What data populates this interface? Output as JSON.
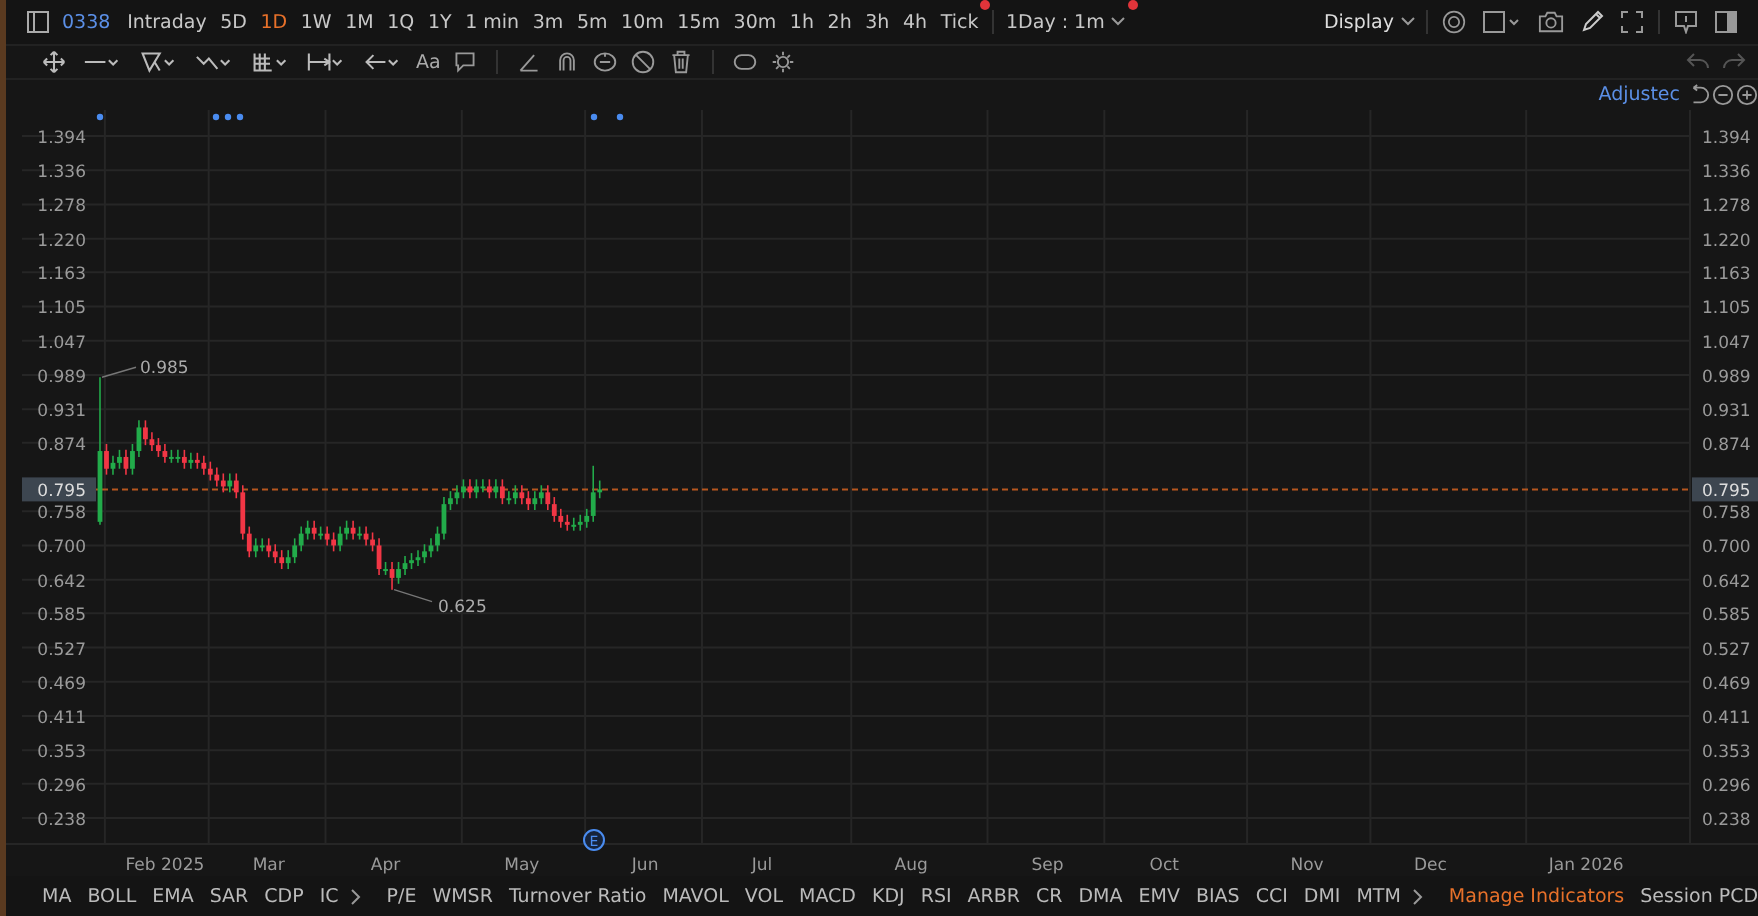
{
  "toolbar": {
    "symbol": "0338",
    "intervals": [
      {
        "label": "Intraday",
        "selected": false,
        "notification": false
      },
      {
        "label": "5D",
        "selected": false,
        "notification": false
      },
      {
        "label": "1D",
        "selected": true,
        "notification": false
      },
      {
        "label": "1W",
        "selected": false,
        "notification": false
      },
      {
        "label": "1M",
        "selected": false,
        "notification": false
      },
      {
        "label": "1Q",
        "selected": false,
        "notification": false
      },
      {
        "label": "1Y",
        "selected": false,
        "notification": false
      },
      {
        "label": "1 min",
        "selected": false,
        "notification": false
      },
      {
        "label": "3m",
        "selected": false,
        "notification": false
      },
      {
        "label": "5m",
        "selected": false,
        "notification": false
      },
      {
        "label": "10m",
        "selected": false,
        "notification": false
      },
      {
        "label": "15m",
        "selected": false,
        "notification": false
      },
      {
        "label": "30m",
        "selected": false,
        "notification": false
      },
      {
        "label": "1h",
        "selected": false,
        "notification": false
      },
      {
        "label": "2h",
        "selected": false,
        "notification": false
      },
      {
        "label": "3h",
        "selected": false,
        "notification": false
      },
      {
        "label": "4h",
        "selected": false,
        "notification": false
      },
      {
        "label": "Tick",
        "selected": false,
        "notification": true
      }
    ],
    "period_select": {
      "value": "1Day : 1m",
      "notification": true
    },
    "display_button": "Display"
  },
  "drawing_tools": {
    "text_tool": "Aa"
  },
  "price_mode": "Adjustec",
  "chart": {
    "chart_data": {
      "type": "candlestick",
      "categories": [
        null,
        null,
        null,
        null,
        null,
        null,
        null,
        null,
        null,
        null,
        "Feb 2025",
        null,
        null,
        null,
        null,
        null,
        null,
        null,
        null,
        null,
        null,
        null,
        null,
        null,
        null,
        null,
        "Mar",
        null,
        null,
        null,
        null,
        null,
        null,
        null,
        null,
        null,
        null,
        null,
        null,
        null,
        null,
        null,
        null,
        null,
        "Apr",
        null,
        null,
        null,
        null,
        null,
        null,
        null,
        null,
        null,
        null,
        null,
        null,
        null,
        null,
        null,
        null,
        null,
        null,
        null,
        null,
        "May",
        null,
        null,
        null,
        null,
        null,
        null,
        null,
        null,
        null,
        null,
        null,
        null,
        null,
        null,
        null,
        null,
        null,
        null,
        "Jun",
        null,
        null,
        null,
        null,
        null,
        null,
        null,
        null,
        null,
        null,
        null,
        null,
        null,
        null,
        null,
        null,
        null,
        "Jul",
        null,
        null,
        null,
        null,
        null,
        null,
        null,
        null,
        null,
        null,
        null,
        null,
        null,
        null,
        null,
        null,
        null,
        null,
        null,
        null,
        null,
        null,
        "Aug",
        null,
        null,
        null,
        null,
        null,
        null,
        null,
        null,
        null,
        null,
        null,
        null,
        null,
        null,
        null,
        null,
        null,
        null,
        null,
        null,
        "Sep",
        null,
        null,
        null,
        null,
        null,
        null,
        null,
        null,
        null,
        null,
        null,
        null,
        null,
        null,
        null,
        null,
        null,
        "Oct",
        null,
        null,
        null,
        null,
        null,
        null,
        null,
        null,
        null,
        null,
        null,
        null,
        null,
        null,
        null,
        null,
        null,
        null,
        null,
        null,
        null,
        "Nov",
        null,
        null,
        null,
        null,
        null,
        null,
        null,
        null,
        null,
        null,
        null,
        null,
        null,
        null,
        null,
        null,
        null,
        null,
        "Dec",
        null,
        null,
        null,
        null,
        null,
        null,
        null,
        null,
        null,
        null,
        null,
        null,
        null,
        null,
        null,
        null,
        null,
        null,
        null,
        null,
        null,
        null,
        null,
        "Jan 2026",
        null,
        null,
        null,
        null,
        null,
        null,
        null,
        null,
        null,
        null,
        null,
        null,
        null,
        null,
        null
      ],
      "ohlc": [
        [
          0.74,
          0.985,
          0.735,
          0.86
        ],
        [
          0.86,
          0.872,
          0.82,
          0.83
        ],
        [
          0.83,
          0.852,
          0.82,
          0.84
        ],
        [
          0.84,
          0.862,
          0.83,
          0.85
        ],
        [
          0.85,
          0.862,
          0.82,
          0.83
        ],
        [
          0.83,
          0.872,
          0.82,
          0.86
        ],
        [
          0.86,
          0.912,
          0.85,
          0.9
        ],
        [
          0.9,
          0.912,
          0.87,
          0.88
        ],
        [
          0.88,
          0.892,
          0.86,
          0.87
        ],
        [
          0.87,
          0.882,
          0.85,
          0.86
        ],
        [
          0.86,
          0.872,
          0.84,
          0.85
        ],
        [
          0.85,
          0.862,
          0.84,
          0.85
        ],
        [
          0.85,
          0.862,
          0.84,
          0.85
        ],
        [
          0.85,
          0.862,
          0.83,
          0.84
        ],
        [
          0.84,
          0.857,
          0.83,
          0.845
        ],
        [
          0.845,
          0.857,
          0.83,
          0.84
        ],
        [
          0.84,
          0.852,
          0.82,
          0.83
        ],
        [
          0.83,
          0.842,
          0.81,
          0.82
        ],
        [
          0.82,
          0.832,
          0.8,
          0.81
        ],
        [
          0.81,
          0.822,
          0.79,
          0.8
        ],
        [
          0.8,
          0.822,
          0.79,
          0.81
        ],
        [
          0.81,
          0.822,
          0.78,
          0.79
        ],
        [
          0.79,
          0.802,
          0.71,
          0.72
        ],
        [
          0.72,
          0.732,
          0.68,
          0.69
        ],
        [
          0.69,
          0.712,
          0.68,
          0.7
        ],
        [
          0.7,
          0.712,
          0.69,
          0.7
        ],
        [
          0.7,
          0.712,
          0.68,
          0.69
        ],
        [
          0.69,
          0.702,
          0.67,
          0.68
        ],
        [
          0.68,
          0.692,
          0.66,
          0.67
        ],
        [
          0.67,
          0.692,
          0.66,
          0.68
        ],
        [
          0.68,
          0.712,
          0.67,
          0.7
        ],
        [
          0.7,
          0.732,
          0.69,
          0.72
        ],
        [
          0.72,
          0.742,
          0.71,
          0.73
        ],
        [
          0.73,
          0.742,
          0.71,
          0.72
        ],
        [
          0.72,
          0.732,
          0.71,
          0.72
        ],
        [
          0.72,
          0.732,
          0.7,
          0.71
        ],
        [
          0.71,
          0.722,
          0.69,
          0.7
        ],
        [
          0.7,
          0.732,
          0.69,
          0.72
        ],
        [
          0.72,
          0.742,
          0.71,
          0.73
        ],
        [
          0.73,
          0.742,
          0.71,
          0.72
        ],
        [
          0.72,
          0.732,
          0.71,
          0.72
        ],
        [
          0.72,
          0.732,
          0.7,
          0.71
        ],
        [
          0.71,
          0.722,
          0.69,
          0.7
        ],
        [
          0.7,
          0.712,
          0.65,
          0.66
        ],
        [
          0.66,
          0.672,
          0.65,
          0.66
        ],
        [
          0.66,
          0.672,
          0.625,
          0.645
        ],
        [
          0.645,
          0.672,
          0.635,
          0.66
        ],
        [
          0.66,
          0.682,
          0.65,
          0.67
        ],
        [
          0.67,
          0.687,
          0.66,
          0.675
        ],
        [
          0.675,
          0.692,
          0.665,
          0.68
        ],
        [
          0.68,
          0.702,
          0.67,
          0.69
        ],
        [
          0.69,
          0.712,
          0.68,
          0.7
        ],
        [
          0.7,
          0.732,
          0.69,
          0.72
        ],
        [
          0.72,
          0.782,
          0.71,
          0.77
        ],
        [
          0.77,
          0.792,
          0.76,
          0.78
        ],
        [
          0.78,
          0.802,
          0.77,
          0.79
        ],
        [
          0.79,
          0.812,
          0.78,
          0.8
        ],
        [
          0.8,
          0.812,
          0.78,
          0.79
        ],
        [
          0.79,
          0.812,
          0.78,
          0.8
        ],
        [
          0.8,
          0.812,
          0.79,
          0.8
        ],
        [
          0.8,
          0.812,
          0.78,
          0.79
        ],
        [
          0.79,
          0.812,
          0.78,
          0.8
        ],
        [
          0.8,
          0.812,
          0.77,
          0.78
        ],
        [
          0.78,
          0.792,
          0.77,
          0.78
        ],
        [
          0.78,
          0.802,
          0.77,
          0.79
        ],
        [
          0.79,
          0.802,
          0.77,
          0.78
        ],
        [
          0.78,
          0.792,
          0.76,
          0.77
        ],
        [
          0.77,
          0.792,
          0.76,
          0.78
        ],
        [
          0.78,
          0.802,
          0.77,
          0.79
        ],
        [
          0.79,
          0.802,
          0.76,
          0.77
        ],
        [
          0.77,
          0.782,
          0.74,
          0.75
        ],
        [
          0.75,
          0.762,
          0.73,
          0.74
        ],
        [
          0.74,
          0.752,
          0.725,
          0.735
        ],
        [
          0.735,
          0.747,
          0.725,
          0.735
        ],
        [
          0.735,
          0.752,
          0.725,
          0.74
        ],
        [
          0.74,
          0.762,
          0.73,
          0.75
        ],
        [
          0.75,
          0.835,
          0.74,
          0.79
        ],
        [
          0.79,
          0.81,
          0.78,
          0.795
        ],
        null,
        null,
        null,
        null,
        null,
        null,
        null,
        null,
        null,
        null,
        null,
        null,
        null,
        null,
        null,
        null,
        null,
        null,
        null,
        null,
        null,
        null,
        null,
        null,
        null,
        null,
        null,
        null,
        null,
        null,
        null,
        null,
        null,
        null,
        null,
        null,
        null,
        null,
        null,
        null,
        null,
        null,
        null,
        null,
        null,
        null,
        null,
        null,
        null,
        null,
        null,
        null,
        null,
        null,
        null,
        null,
        null,
        null,
        null,
        null,
        null,
        null,
        null,
        null,
        null,
        null,
        null,
        null,
        null,
        null,
        null,
        null,
        null,
        null,
        null,
        null,
        null,
        null,
        null,
        null,
        null,
        null,
        null,
        null,
        null,
        null,
        null,
        null,
        null,
        null,
        null,
        null,
        null,
        null,
        null,
        null,
        null,
        null,
        null,
        null,
        null,
        null,
        null,
        null,
        null,
        null,
        null,
        null,
        null,
        null,
        null,
        null,
        null,
        null,
        null,
        null,
        null,
        null,
        null,
        null,
        null,
        null,
        null,
        null,
        null,
        null,
        null,
        null,
        null,
        null,
        null,
        null,
        null,
        null,
        null,
        null,
        null,
        null,
        null,
        null,
        null,
        null,
        null,
        null,
        null,
        null,
        null,
        null,
        null,
        null,
        null,
        null,
        null,
        null,
        null,
        null,
        null,
        null,
        null,
        null,
        null,
        null,
        null,
        null,
        null,
        null,
        null
      ],
      "ylim": [
        0.194,
        1.438
      ],
      "grid": true,
      "yticks": [
        {
          "value": 1.394,
          "label": "1.394"
        },
        {
          "value": 1.336,
          "label": "1.336"
        },
        {
          "value": 1.278,
          "label": "1.278"
        },
        {
          "value": 1.22,
          "label": "1.220"
        },
        {
          "value": 1.163,
          "label": "1.163"
        },
        {
          "value": 1.105,
          "label": "1.105"
        },
        {
          "value": 1.047,
          "label": "1.047"
        },
        {
          "value": 0.989,
          "label": "0.989"
        },
        {
          "value": 0.931,
          "label": "0.931"
        },
        {
          "value": 0.874,
          "label": "0.874"
        },
        {
          "value": 0.758,
          "label": "0.758"
        },
        {
          "value": 0.7,
          "label": "0.700"
        },
        {
          "value": 0.642,
          "label": "0.642"
        },
        {
          "value": 0.585,
          "label": "0.585"
        },
        {
          "value": 0.527,
          "label": "0.527"
        },
        {
          "value": 0.469,
          "label": "0.469"
        },
        {
          "value": 0.411,
          "label": "0.411"
        },
        {
          "value": 0.353,
          "label": "0.353"
        },
        {
          "value": 0.296,
          "label": "0.296"
        },
        {
          "value": 0.238,
          "label": "0.238"
        }
      ],
      "ref_lines": [
        {
          "axis": "y",
          "value": 0.795
        }
      ],
      "annotations": [
        "0.985",
        "0.625"
      ]
    },
    "left_axis_labels": [
      "1.394",
      "1.336",
      "1.278",
      "1.220",
      "1.163",
      "1.105",
      "1.047",
      "0.989",
      "0.931",
      "0.874",
      "0.758",
      "0.700",
      "0.642",
      "0.585",
      "0.527",
      "0.469",
      "0.411",
      "0.353",
      "0.296",
      "0.238"
    ],
    "last_price_labels": [
      "0.795",
      "0.795"
    ],
    "event_marker": "E"
  },
  "indicators": {
    "main": [
      "MA",
      "BOLL",
      "EMA",
      "SAR",
      "CDP",
      "IC"
    ],
    "sub": [
      "P/E",
      "WMSR",
      "Turnover Ratio",
      "MAVOL",
      "VOL",
      "MACD",
      "KDJ",
      "RSI",
      "ARBR",
      "CR",
      "DMA",
      "EMV",
      "BIAS",
      "CCI",
      "DMI",
      "MTM"
    ],
    "manage": "Manage Indicators",
    "session": "Session PCD"
  }
}
